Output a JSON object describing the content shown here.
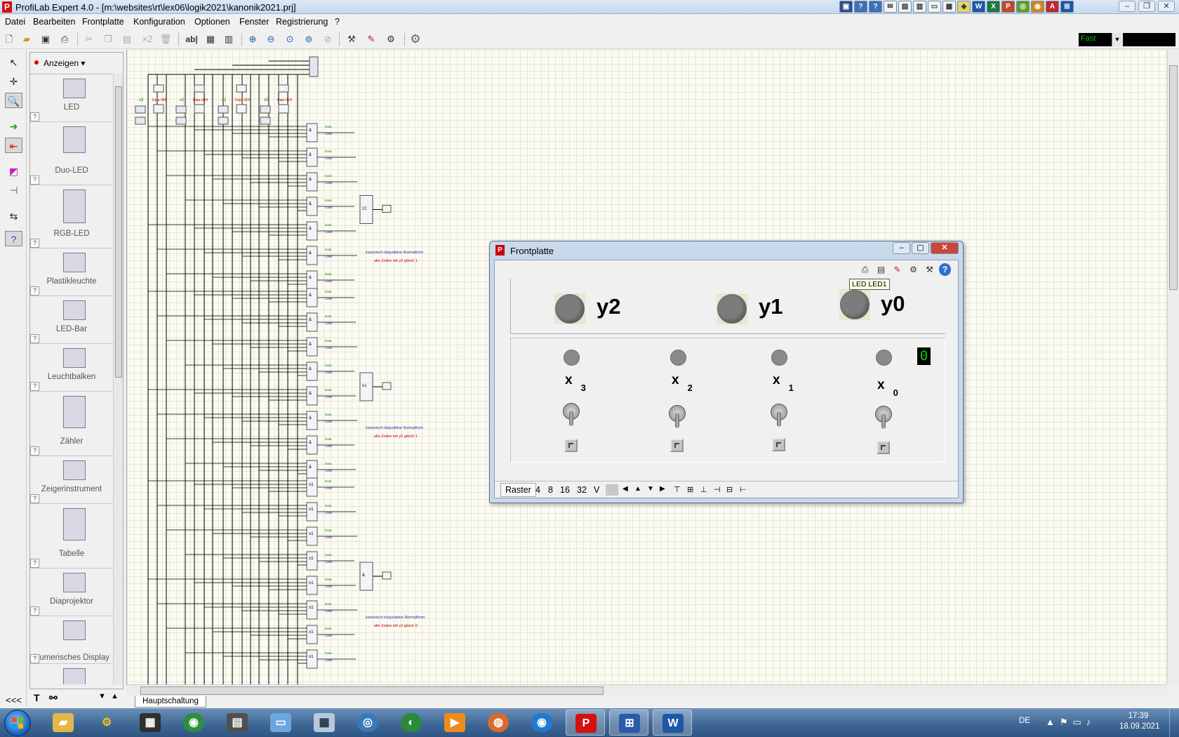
{
  "window": {
    "title": "ProfiLab Expert 4.0 - [m:\\websites\\rt\\lex06\\logik2021\\kanonik2021.prj]"
  },
  "menu": [
    "Datei",
    "Bearbeiten",
    "Frontplatte",
    "Konfiguration",
    "Optionen",
    "Fenster",
    "Registrierung",
    "?"
  ],
  "toolbar": {
    "text_tool_label": "ab|",
    "multiply_label": "×2",
    "speed_value": "Fast"
  },
  "palette": {
    "category": "Anzeigen",
    "items": [
      {
        "name": "LED",
        "tag": "LED0"
      },
      {
        "name": "Duo-LED",
        "tag": "DLED0"
      },
      {
        "name": "RGB-LED",
        "tag": "RGB0"
      },
      {
        "name": "Plastikleuchte",
        "tag": "LA0"
      },
      {
        "name": "LED-Bar",
        "tag": "LB0"
      },
      {
        "name": "Leuchtbalken",
        "tag": "LB0"
      },
      {
        "name": "Zähler",
        "tag": "CO0"
      },
      {
        "name": "Zeigerinstrument",
        "tag": "MI0"
      },
      {
        "name": "Tabelle",
        "tag": "TAB0"
      },
      {
        "name": "Diaprojektor",
        "tag": "PJ0"
      },
      {
        "name": "Numerisches Display",
        "tag": "ND0"
      },
      {
        "name": "",
        "tag": "TX0"
      }
    ],
    "help_label": "?",
    "collapse_label": "<<<"
  },
  "schematic": {
    "inputs": [
      "x3",
      "x2",
      "x1",
      "x0"
    ],
    "data_labels": [
      "Data 08H",
      "Data 04H",
      "Data 02H",
      "Data 01H"
    ],
    "group1_caption": [
      "kanonisch disjunktive Normalform",
      "alle Zeilen mit y2 gleich 1"
    ],
    "group2_caption": [
      "kanonisch disjunktive Normalform",
      "alle Zeilen mit y1 gleich 1"
    ],
    "group3_caption": [
      "kanonisch konjunktive Normalform",
      "alle Zeilen mit y2 gleich 0"
    ],
    "and_symbol": "&",
    "or_symbol": "≥1"
  },
  "tabs": {
    "active": "Hauptschaltung"
  },
  "frontplatte": {
    "title": "Frontplatte",
    "tooltip": "LED LED1",
    "outputs": [
      "y2",
      "y1",
      "y0"
    ],
    "inputs": [
      {
        "label": "x",
        "index": "3"
      },
      {
        "label": "x",
        "index": "2"
      },
      {
        "label": "x",
        "index": "1"
      },
      {
        "label": "x",
        "index": "0"
      }
    ],
    "numeric_display": "0",
    "status": {
      "raster": "Raster",
      "values": [
        "4",
        "8",
        "16",
        "32",
        "V"
      ]
    }
  },
  "tray": {
    "language": "DE",
    "time": "17:39",
    "date": "18.09.2021"
  },
  "colors": {
    "led_off": "#7c7c7c",
    "numeric_fg": "#00cc00",
    "caption_blue": "#1a2fb0",
    "caption_red": "#d00000",
    "data_green": "#0a8a0a"
  }
}
